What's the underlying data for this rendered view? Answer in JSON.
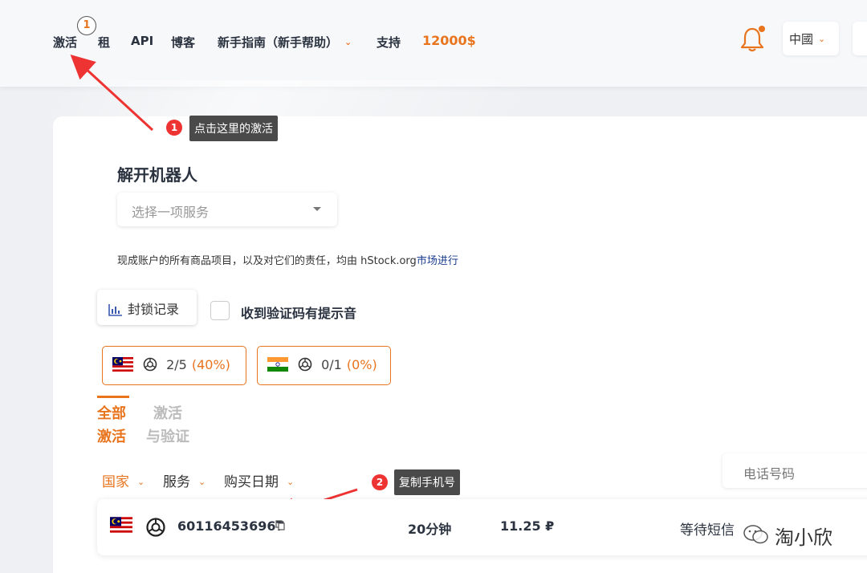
{
  "nav": {
    "items": [
      "激活",
      "租",
      "API",
      "博客",
      "新手指南（新手帮助）",
      "支持"
    ],
    "balance": "12000$",
    "step_number": "1"
  },
  "language": {
    "selected": "中國"
  },
  "annotations": {
    "tip1_number": "1",
    "tip1_text": "点击这里的激活",
    "tip2_number": "2",
    "tip2_text": "复制手机号"
  },
  "main": {
    "title": "解开机器人",
    "service_placeholder": "选择一项服务",
    "disclaimer_text": "现成账户的所有商品项目，以及对它们的责任，均由 hStock.org",
    "disclaimer_link": "市场进行",
    "block_log_label": "封锁记录",
    "sound_checkbox_label": "收到验证码有提示音",
    "countries": [
      {
        "icon": "malaysia-flag",
        "count": "2/5",
        "percent": "(40%)"
      },
      {
        "icon": "india-flag",
        "count": "0/1",
        "percent": "(0%)"
      }
    ],
    "tabs": {
      "all_line1": "全部",
      "all_line2": "激活",
      "verify_line1": "激活",
      "verify_line2": "与验证"
    },
    "filters": [
      "国家",
      "服务",
      "购买日期"
    ],
    "phone_search_placeholder": "电话号码",
    "order": {
      "icon": "malaysia-flag",
      "service_icon": "openai-icon",
      "phone": "601164536967",
      "duration": "20分钟",
      "price": "11.25 ₽",
      "status": "等待短信"
    }
  },
  "watermark": "淘小欣",
  "colors": {
    "accent": "#e8741e",
    "dark_text": "#2b3340",
    "annotation_red": "#e33"
  }
}
